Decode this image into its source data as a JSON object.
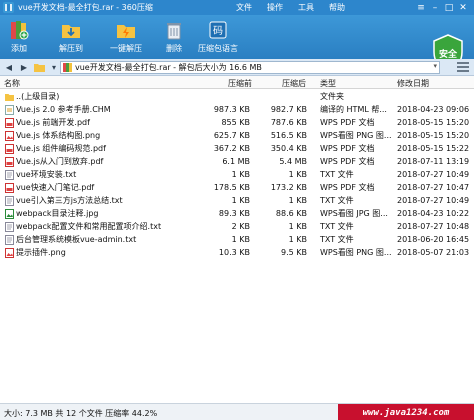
{
  "window": {
    "title": "vue开发文档-最全打包.rar - 360压缩",
    "menu": [
      "文件",
      "操作",
      "工具",
      "帮助"
    ]
  },
  "toolbar": {
    "add": "添加",
    "extract_to": "解压到",
    "one_click_extract": "一键解压",
    "delete": "删除",
    "password": "压缩包语言",
    "safe": "安全"
  },
  "address": {
    "path": "vue开发文档-最全打包.rar - 解包后大小为 16.6 MB"
  },
  "columns": {
    "name": "名称",
    "compressed": "压缩前",
    "original": "压缩后",
    "type": "类型",
    "modified": "修改日期"
  },
  "rows": [
    {
      "name": "..(上级目录)",
      "csize": "",
      "osize": "",
      "type": "文件夹",
      "date": ""
    },
    {
      "name": "Vue.js 2.0 参考手册.CHM",
      "csize": "987.3 KB",
      "osize": "982.7 KB",
      "type": "编译的 HTML 帮...",
      "date": "2018-04-23 09:06"
    },
    {
      "name": "Vue.js 前端开发.pdf",
      "csize": "855 KB",
      "osize": "787.6 KB",
      "type": "WPS PDF 文档",
      "date": "2018-05-15 15:20"
    },
    {
      "name": "Vue.js 体系结构图.png",
      "csize": "625.7 KB",
      "osize": "516.5 KB",
      "type": "WPS看图 PNG 图...",
      "date": "2018-05-15 15:20"
    },
    {
      "name": "Vue.js 组件编码规范.pdf",
      "csize": "367.2 KB",
      "osize": "350.4 KB",
      "type": "WPS PDF 文档",
      "date": "2018-05-15 15:22"
    },
    {
      "name": "Vue.js从入门到放弃.pdf",
      "csize": "6.1 MB",
      "osize": "5.4 MB",
      "type": "WPS PDF 文档",
      "date": "2018-07-11 13:19"
    },
    {
      "name": "vue环境安装.txt",
      "csize": "1 KB",
      "osize": "1 KB",
      "type": "TXT 文件",
      "date": "2018-07-27 10:49"
    },
    {
      "name": "vue快速入门笔记.pdf",
      "csize": "178.5 KB",
      "osize": "173.2 KB",
      "type": "WPS PDF 文档",
      "date": "2018-07-27 10:47"
    },
    {
      "name": "vue引入第三方js方法总结.txt",
      "csize": "1 KB",
      "osize": "1 KB",
      "type": "TXT 文件",
      "date": "2018-07-27 10:49"
    },
    {
      "name": "webpack目录注释.jpg",
      "csize": "89.3 KB",
      "osize": "88.6 KB",
      "type": "WPS看图 JPG 图...",
      "date": "2018-04-23 10:22"
    },
    {
      "name": "webpack配置文件和常用配置项介绍.txt",
      "csize": "2 KB",
      "osize": "1 KB",
      "type": "TXT 文件",
      "date": "2018-07-27 10:48"
    },
    {
      "name": "后台管理系统模板vue-admin.txt",
      "csize": "1 KB",
      "osize": "1 KB",
      "type": "TXT 文件",
      "date": "2018-06-20 16:45"
    },
    {
      "name": "提示插件.png",
      "csize": "10.3 KB",
      "osize": "9.5 KB",
      "type": "WPS看图 PNG 图...",
      "date": "2018-05-07 21:03"
    }
  ],
  "status": {
    "text": "大小: 7.3 MB 共 12 个文件 压缩率 44.2%",
    "watermark": "www.java1234.com"
  },
  "colors": {
    "accent": "#2d86cc",
    "safe_green": "#3aa53c",
    "watermark_red": "#c8102e"
  },
  "icons": {
    "folder": "folder-icon",
    "chm": "chm-icon",
    "pdf": "pdf-icon",
    "image": "image-icon",
    "txt": "txt-icon"
  }
}
